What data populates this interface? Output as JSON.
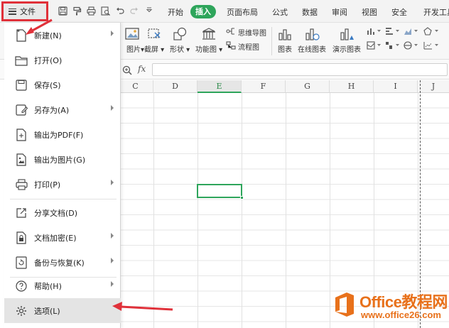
{
  "menubar": {
    "file_label": "文件",
    "tabs": [
      {
        "label": "开始"
      },
      {
        "label": "插入"
      },
      {
        "label": "页面布局"
      },
      {
        "label": "公式"
      },
      {
        "label": "数据"
      },
      {
        "label": "审阅"
      },
      {
        "label": "视图"
      },
      {
        "label": "安全"
      },
      {
        "label": "开发工具"
      }
    ],
    "active_tab": "插入"
  },
  "ribbon": {
    "picture_label": "图片",
    "screenshot_label": "截屏",
    "shapes_label": "形状",
    "smartart_label": "功能图",
    "qrcode_label": "思维导图",
    "flowchart_label": "流程图",
    "chart_label": "图表",
    "online_chart_label": "在线图表",
    "demo_chart_label": "演示图表"
  },
  "formula_bar": {
    "fx_label": "fx",
    "value": ""
  },
  "sheet": {
    "columns": [
      "C",
      "D",
      "E",
      "F",
      "G",
      "H",
      "I",
      "J"
    ],
    "selected_column": "E"
  },
  "file_menu": {
    "items": [
      {
        "label": "新建(N)",
        "icon": "new-file-icon",
        "submenu": true
      },
      {
        "label": "打开(O)",
        "icon": "folder-icon",
        "submenu": false
      },
      {
        "label": "保存(S)",
        "icon": "save-icon",
        "submenu": false
      },
      {
        "label": "另存为(A)",
        "icon": "save-as-icon",
        "submenu": true
      },
      {
        "label": "输出为PDF(F)",
        "icon": "export-pdf-icon",
        "submenu": false
      },
      {
        "label": "输出为图片(G)",
        "icon": "export-image-icon",
        "submenu": false
      },
      {
        "label": "打印(P)",
        "icon": "printer-icon",
        "submenu": true
      },
      {
        "label": "分享文档(D)",
        "icon": "share-icon",
        "submenu": false
      },
      {
        "label": "文档加密(E)",
        "icon": "lock-document-icon",
        "submenu": true
      },
      {
        "label": "备份与恢复(K)",
        "icon": "backup-icon",
        "submenu": true
      },
      {
        "label": "帮助(H)",
        "icon": "help-icon",
        "submenu": true
      },
      {
        "label": "选项(L)",
        "icon": "gear-icon",
        "submenu": false
      }
    ],
    "highlighted": "选项(L)"
  },
  "watermark": {
    "title": "Office教程网",
    "url": "www.office26.com",
    "brand_color": "#e8711b"
  },
  "colors": {
    "accent_green": "#2ea55b",
    "annotation_red": "#e0313a"
  }
}
